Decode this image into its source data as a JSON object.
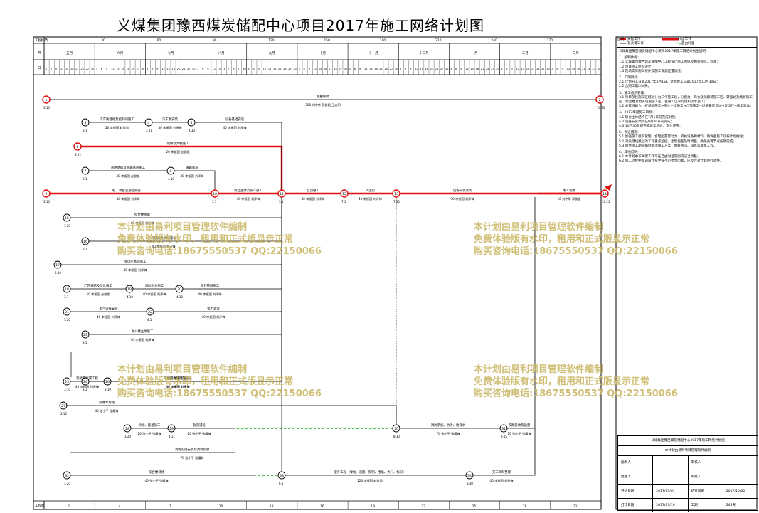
{
  "title": "义煤集团豫西煤炭储配中心项目2017年施工网络计划图",
  "header": {
    "label_engineering_days": "工程标尺",
    "label_month": "月",
    "label_day": "日",
    "label_footer": "工程周",
    "months": [
      "五月",
      "六月",
      "七月",
      "八月",
      "九月",
      "十月",
      "十一月",
      "十二月",
      "一月",
      "二月",
      "三月"
    ],
    "top_scale": [
      "0",
      "30",
      "60",
      "90",
      "120",
      "150",
      "180",
      "210",
      "240",
      "270"
    ],
    "bottom_scale": [
      "1",
      "4",
      "7",
      "10",
      "13",
      "16",
      "19",
      "22",
      "25",
      "28",
      "31"
    ]
  },
  "nodes": [
    {
      "id": "1",
      "date": "3.10"
    },
    {
      "id": "2",
      "date": "10.30"
    },
    {
      "id": "3",
      "date": "3.1"
    },
    {
      "id": "4",
      "date": "3.21"
    },
    {
      "id": "5",
      "date": "4.30"
    },
    {
      "id": "6",
      "date": "3.22"
    },
    {
      "id": "7",
      "date": "3.1"
    },
    {
      "id": "8",
      "date": "4.10"
    },
    {
      "id": "9",
      "date": "3.10"
    },
    {
      "id": "10",
      "date": "3.1"
    },
    {
      "id": "11",
      "date": "3.1"
    },
    {
      "id": "12",
      "date": "7.1"
    },
    {
      "id": "13",
      "date": "7.30"
    },
    {
      "id": "14",
      "date": "10.21"
    },
    {
      "id": "15",
      "date": "3.20"
    },
    {
      "id": "16",
      "date": "3.1"
    },
    {
      "id": "17",
      "date": "3.10"
    },
    {
      "id": "18",
      "date": "3.1"
    },
    {
      "id": "19",
      "date": "4.10"
    },
    {
      "id": "20",
      "date": "4.10"
    },
    {
      "id": "21",
      "date": "3.20"
    },
    {
      "id": "22",
      "date": "4.1"
    },
    {
      "id": "23",
      "date": "3.1"
    },
    {
      "id": "24",
      "date": "3.1"
    },
    {
      "id": "25",
      "date": "3.10"
    },
    {
      "id": "26",
      "date": "3.10"
    },
    {
      "id": "27",
      "date": "3.10"
    },
    {
      "id": "28",
      "date": "3.20"
    },
    {
      "id": "29",
      "date": "4.11"
    },
    {
      "id": "30",
      "date": "8.30"
    },
    {
      "id": "31",
      "date": "9.15"
    },
    {
      "id": "32",
      "date": "3.20"
    },
    {
      "id": "33",
      "date": "6.1"
    },
    {
      "id": "34",
      "date": "8.30"
    }
  ],
  "activities": [
    {
      "label": "后勤保障",
      "dur": "300 刘中华 郭俊凯 王志明"
    },
    {
      "label": "汽车衡基础及控制间施工",
      "dur": "20 李振国 赵俊凯"
    },
    {
      "label": "汽车衡安装",
      "dur": "40 李振国 刘泽锋"
    },
    {
      "label": "设备基础安装",
      "dur": "40 李振国 刘泽锋"
    },
    {
      "label": "储煤场大棚施工",
      "dur": "20 李振国 赵俊凯"
    },
    {
      "label": "道路基础及道路基层施工",
      "dur": "40 李振国 赵俊凯"
    },
    {
      "label": "道路面层",
      "dur": "40 李振国 刘泽锋"
    },
    {
      "label": "桩、承台及基础梁施工",
      "dur": "40 李振国 刘泽锋"
    },
    {
      "label": "筒仓主体及漏斗施工",
      "dur": "40 李振国 刘泽锋"
    },
    {
      "label": "储煤场地坪、设备基础施工",
      "dur": "40 李振国 刘泽锋"
    },
    {
      "label": "仓顶施工",
      "dur": "40 李振国 刘泽锋"
    },
    {
      "label": "试运行",
      "dur": "40 李振国 刘泽锋"
    },
    {
      "label": "设备安装调试",
      "dur": "90 李振国 刘泽锋"
    },
    {
      "label": "竣工验收",
      "dur": "10 刘中华 郭俊凯"
    },
    {
      "label": "综合楼基础",
      "dur": "40 李振国 刘泽锋"
    },
    {
      "label": "转运站及栈桥施工",
      "dur": "40 李振国 刘泽锋"
    },
    {
      "label": "变电所基础施工",
      "dur": "40 李振国 刘泽锋"
    },
    {
      "label": "厂区道路及绿化施工",
      "dur": "50 李振国 赵俊凯"
    },
    {
      "label": "消防水池施工",
      "dur": "40 李振国 刘泽锋"
    },
    {
      "label": "室外管网施工",
      "dur": "40 李振国 刘泽锋"
    },
    {
      "label": "电气设备安装",
      "dur": "40 李振国 刘泽锋"
    },
    {
      "label": "电力调试",
      "dur": "40 李振国 刘泽锋"
    },
    {
      "label": "办公楼主体施工",
      "dur": "40 李振国 刘泽锋"
    },
    {
      "label": "装修及附属工程",
      "dur": "40 李振国 刘泽锋"
    },
    {
      "label": "给排水管网施工",
      "dur": "40 李振国 刘泽锋"
    },
    {
      "label": "环保设备基础及安装",
      "dur": "40 李振国 刘泽锋"
    },
    {
      "label": "锅炉房施工",
      "dur": "40 李振国 刘泽锋"
    },
    {
      "label": "生产系统联动调试",
      "dur": "40 李振国 刘泽锋"
    },
    {
      "label": "铁路专用线",
      "dur": "40 张小平 张耀锋"
    },
    {
      "label": "桥涵、路基施工",
      "dur": "20 张小平 张耀锋"
    },
    {
      "label": "轨道铺设",
      "dur": "20 张小平 张耀锋"
    },
    {
      "label": "消防系统、防洪、给排水",
      "dur": "70 张小平 张耀锋"
    },
    {
      "label": "铁路验收及运营",
      "dur": "10 张小平 张耀锋"
    },
    {
      "label": "消防设施安装及调试验收",
      "dur": "70 张小平 张耀锋"
    },
    {
      "label": "综合楼装修",
      "dur": "40 张小平 张耀锋"
    },
    {
      "label": "室外工程（绿化、道路、照明、围墙、大门、标识）",
      "dur": "120 李振国 赵俊凯"
    },
    {
      "label": "交工资料整理",
      "dur": "40 李振国 刘泽锋"
    }
  ],
  "watermark": {
    "line1": "本计划由易利项目管理软件编制",
    "line2": "免费体验版有水印，租用和正式版显示正常",
    "line3": "购买咨询电话:18675550537 QQ:22150066"
  },
  "legend": {
    "critical": "关键工作",
    "normal": "非关键工作",
    "virtual": "虚工作",
    "float": "自由时差",
    "heading": "图例："
  },
  "notes": {
    "title": "义煤集团豫西煤炭储配中心项目2017年施工网络计划图说明",
    "items": [
      "1、编制依据：",
      "1.1 义煤集团豫西煤炭储配中心工程设计施工图纸及相关规范、标准；",
      "1.2 项目施工组织设计；",
      "1.3 现场实际施工条件及施工资源配置情况。",
      "2、工期目标：",
      "2.1 计划开工日期2017年3月1日，计划竣工日期2017年10月30日；",
      "2.2 合同工期244天。",
      "3、施工组织安排：",
      "3.1 项目部按施工区域划分为三个施工段，分别为：筒仓及储煤场施工区、转运站及栈桥施工区、综合楼及附属设施施工区，各施工区平行组织流水施工；",
      "3.2 关键线路为：桩基础施工→筒仓主体施工→仓顶施工→设备安装调试→试运行→竣工验收。",
      "4、2017年度施工目标：",
      "4.1 筒仓主体结构在7月1日前完成封顶；",
      "4.2 设备安装调试在9月30日前完成；",
      "4.3 10月30日前完成竣工验收，交付使用。",
      "5、保证措施：",
      "5.1 加强施工组织管理，合理配置劳动力、机械设备和材料，确保各施工段按计划推进；",
      "5.2 对关键线路上的工作重点监控，出现偏差及时调整，确保关键节点按期完成；",
      "5.3 雨季施工期间编制专项施工方案，做好防汛、排水等准备工作。",
      "6、其他说明：",
      "6.1 本计划中非关键工作可在自由时差范围内适当调整；",
      "6.2 施工过程中如遇设计变更或不可抗力因素，应及时对计划进行调整。"
    ]
  },
  "info_table": {
    "title": "义煤集团豫西煤炭储配中心2017年施工网络计划图",
    "subtitle": "本计划由易利项目管理软件编制",
    "rows": [
      [
        "编制人",
        "",
        "审核人",
        ""
      ],
      [
        "批准人",
        "",
        "审批人",
        ""
      ],
      [
        "开始日期",
        "2017/03/01",
        "结束日期",
        "2017/10/30"
      ],
      [
        "打印日期",
        "2017/03/10",
        "工期",
        "244天"
      ]
    ]
  },
  "colors": {
    "critical": "#e01010",
    "normal": "#000000",
    "float": "#22aa22",
    "watermark": "#c8b560"
  }
}
